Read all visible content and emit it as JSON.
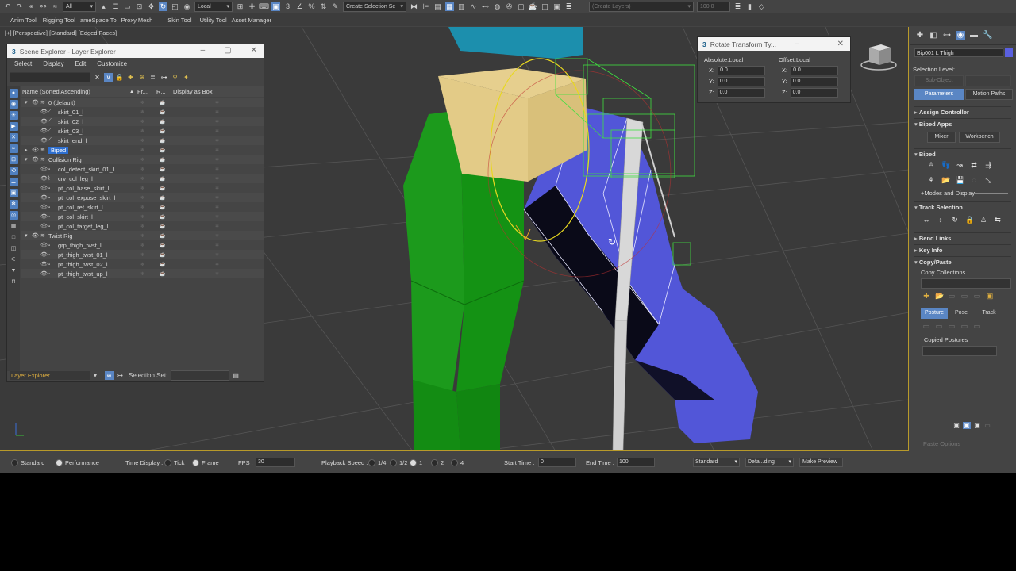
{
  "toolbar": {
    "filter_select": "All",
    "coord_select": "Local",
    "selection_set": "Create Selection Se",
    "layers_dropdown": "(Create Layers)",
    "value_field": "100.0"
  },
  "ribbon": [
    "Anim Tool",
    "Rigging Tool",
    "ameSpace To",
    "Proxy Mesh",
    "Skin Tool",
    "Utility Tool",
    "Asset Manager"
  ],
  "viewport_label": "[+] [Perspective] [Standard] [Edged Faces]",
  "scene_explorer": {
    "title": "Scene Explorer - Layer Explorer",
    "menu": [
      "Select",
      "Display",
      "Edit",
      "Customize"
    ],
    "columns": {
      "name": "Name (Sorted Ascending)",
      "fr": "Fr...",
      "r": "R...",
      "display_box": "Display as Box"
    },
    "rows": [
      {
        "label": "0 (default)",
        "indent": 0,
        "expand": "▾",
        "icon": "layer"
      },
      {
        "label": "skirt_01_l",
        "indent": 1,
        "expand": "",
        "icon": "bone"
      },
      {
        "label": "skirt_02_l",
        "indent": 1,
        "expand": "",
        "icon": "bone"
      },
      {
        "label": "skirt_03_l",
        "indent": 1,
        "expand": "",
        "icon": "bone"
      },
      {
        "label": "skirt_end_l",
        "indent": 1,
        "expand": "",
        "icon": "bone"
      },
      {
        "label": "Biped",
        "indent": 0,
        "expand": "▸",
        "icon": "layer",
        "selected": true
      },
      {
        "label": "Collision Rig",
        "indent": 0,
        "expand": "▾",
        "icon": "layer"
      },
      {
        "label": "col_detect_skirt_01_l",
        "indent": 1,
        "expand": "",
        "icon": "helper"
      },
      {
        "label": "crv_col_leg_l",
        "indent": 1,
        "expand": "",
        "icon": "spline"
      },
      {
        "label": "pt_col_base_skirt_l",
        "indent": 1,
        "expand": "",
        "icon": "helper"
      },
      {
        "label": "pt_col_expose_skirt_l",
        "indent": 1,
        "expand": "",
        "icon": "helper"
      },
      {
        "label": "pt_col_ref_skirt_l",
        "indent": 1,
        "expand": "",
        "icon": "helper"
      },
      {
        "label": "pt_col_skirt_l",
        "indent": 1,
        "expand": "",
        "icon": "helper"
      },
      {
        "label": "pt_col_target_leg_l",
        "indent": 1,
        "expand": "",
        "icon": "helper"
      },
      {
        "label": "Twist Rig",
        "indent": 0,
        "expand": "▾",
        "icon": "layer"
      },
      {
        "label": "grp_thigh_twst_l",
        "indent": 1,
        "expand": "",
        "icon": "helper"
      },
      {
        "label": "pt_thigh_twst_01_l",
        "indent": 1,
        "expand": "",
        "icon": "helper"
      },
      {
        "label": "pt_thigh_twst_02_l",
        "indent": 1,
        "expand": "",
        "icon": "helper"
      },
      {
        "label": "pt_thigh_twst_up_l",
        "indent": 1,
        "expand": "",
        "icon": "helper"
      }
    ],
    "footer": {
      "explorer": "Layer Explorer",
      "selection_set_label": "Selection Set:"
    }
  },
  "rotate_transform": {
    "title": "Rotate Transform Ty...",
    "absolute": {
      "header": "Absolute:Local",
      "x": "0.0",
      "y": "0.0",
      "z": "0.0"
    },
    "offset": {
      "header": "Offset:Local",
      "x": "0.0",
      "y": "0.0",
      "z": "0.0"
    }
  },
  "command_panel": {
    "object_name": "Bip001 L Thigh",
    "selection_level": "Selection Level:",
    "sub_object": "Sub-Object",
    "parameters": "Parameters",
    "motion_paths": "Motion Paths",
    "assign_controller": "Assign Controller",
    "biped_apps": "Biped Apps",
    "mixer": "Mixer",
    "workbench": "Workbench",
    "biped": "Biped",
    "modes_display": "+Modes and Display",
    "track_selection": "Track Selection",
    "bend_links": "Bend Links",
    "key_info": "Key Info",
    "copy_paste": "Copy/Paste",
    "copy_collections": "Copy Collections",
    "posture": "Posture",
    "pose": "Pose",
    "track": "Track",
    "copied_postures": "Copied Postures",
    "paste_options": "Paste Options"
  },
  "status_bar": {
    "standard": "Standard",
    "performance": "Performance",
    "time_display": "Time Display :",
    "tick": "Tick",
    "frame": "Frame",
    "fps_label": "FPS :",
    "fps": "30",
    "playback_speed": "Playback Speed :",
    "speeds": [
      "1/4",
      "1/2",
      "1",
      "2",
      "4"
    ],
    "start_time_label": "Start Time :",
    "start_time": "0",
    "end_time_label": "End Time :",
    "end_time": "100",
    "view_mode": "Standard",
    "default_shading": "Defa...ding",
    "make_preview": "Make Preview"
  },
  "colors": {
    "accent": "#5a86c4",
    "selection_blue": "#2e6fd0",
    "green_body": "#1a9a1a",
    "blue_leg": "#5055d8",
    "tan_block": "#e6cf8e",
    "cyan_block": "#1d8fae"
  }
}
